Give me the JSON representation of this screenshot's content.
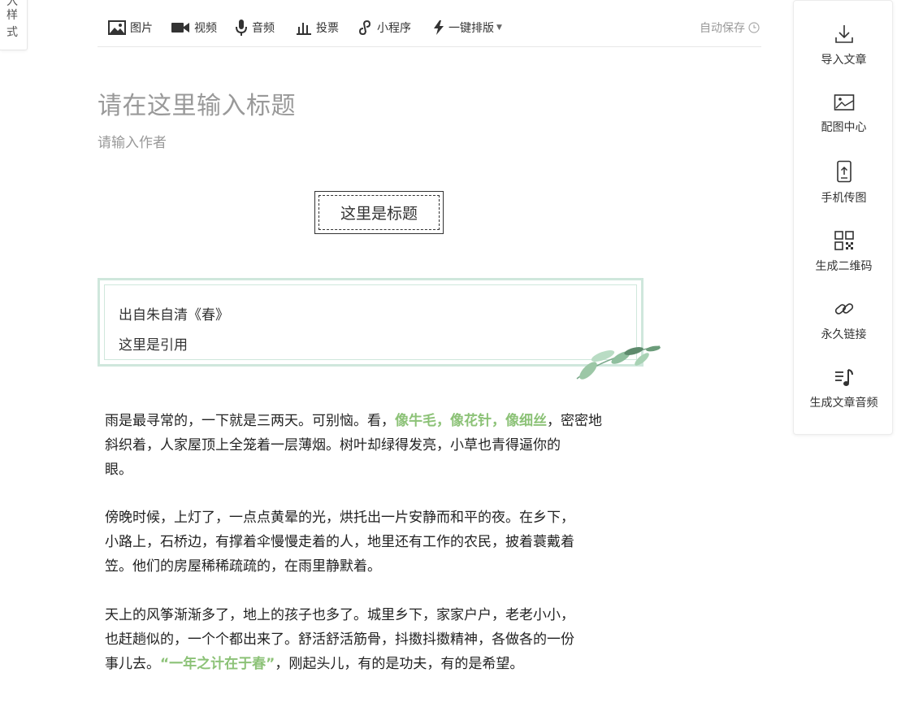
{
  "left_tab": {
    "chars": [
      "入",
      "样",
      "式"
    ]
  },
  "toolbar": {
    "items": [
      {
        "label": "图片",
        "icon": "image-icon"
      },
      {
        "label": "视频",
        "icon": "video-icon"
      },
      {
        "label": "音频",
        "icon": "microphone-icon"
      },
      {
        "label": "投票",
        "icon": "bar-chart-icon"
      },
      {
        "label": "小程序",
        "icon": "mini-program-icon"
      },
      {
        "label": "一键排版",
        "icon": "lightning-icon"
      }
    ],
    "autosave": "自动保存"
  },
  "editor": {
    "title_placeholder": "请在这里输入标题",
    "author_placeholder": "请输入作者",
    "heading": "这里是标题",
    "quote": {
      "source": "出自朱自清《春》",
      "text": "这里是引用"
    },
    "paragraphs": [
      {
        "l1a": "雨是最寻常的，一下就是三两天。可别恼。看，",
        "l1hl": "像牛毛，像花针，像细丝",
        "l1b": "，密密地",
        "l2": "斜织着，人家屋顶上全笼着一层薄烟。树叶却绿得发亮，小草也青得逼你的",
        "l3": "眼。"
      },
      {
        "l1": "傍晚时候，上灯了，一点点黄晕的光，烘托出一片安静而和平的夜。在乡下，",
        "l2": "小路上，石桥边，有撑着伞慢慢走着的人，地里还有工作的农民，披着蓑戴着",
        "l3": "笠。他们的房屋稀稀疏疏的，在雨里静默着。"
      },
      {
        "l1": "天上的风筝渐渐多了，地上的孩子也多了。城里乡下，家家户户，老老小小，",
        "l2": "也赶趟似的，一个个都出来了。舒活舒活筋骨，抖擞抖擞精神，各做各的一份",
        "l3a": "事儿去。",
        "l3hl": "“一年之计在于春”",
        "l3b": "，刚起头儿，有的是功夫，有的是希望。"
      }
    ]
  },
  "sidepanel": {
    "items": [
      {
        "label": "导入文章",
        "icon": "import-icon"
      },
      {
        "label": "配图中心",
        "icon": "picture-icon"
      },
      {
        "label": "手机传图",
        "icon": "phone-upload-icon"
      },
      {
        "label": "生成二维码",
        "icon": "qrcode-icon"
      },
      {
        "label": "永久链接",
        "icon": "link-icon"
      },
      {
        "label": "生成文章音频",
        "icon": "music-note-icon"
      }
    ]
  },
  "colors": {
    "accent_green": "#8cc277",
    "quote_border": "#cfe7dc",
    "placeholder": "#999999"
  }
}
